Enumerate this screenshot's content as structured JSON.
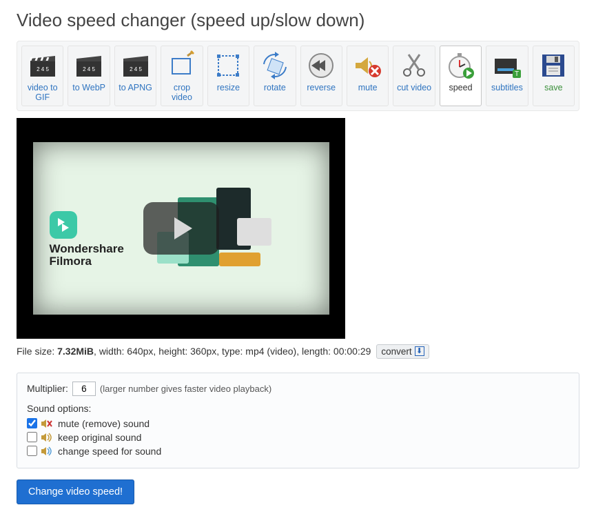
{
  "title": "Video speed changer (speed up/slow down)",
  "toolbar": [
    {
      "key": "gif",
      "label": "video to GIF",
      "active": false
    },
    {
      "key": "webp",
      "label": "to WebP",
      "active": false
    },
    {
      "key": "apng",
      "label": "to APNG",
      "active": false
    },
    {
      "key": "crop",
      "label": "crop video",
      "active": false
    },
    {
      "key": "resize",
      "label": "resize",
      "active": false
    },
    {
      "key": "rotate",
      "label": "rotate",
      "active": false
    },
    {
      "key": "reverse",
      "label": "reverse",
      "active": false
    },
    {
      "key": "mute",
      "label": "mute",
      "active": false
    },
    {
      "key": "cut",
      "label": "cut video",
      "active": false
    },
    {
      "key": "speed",
      "label": "speed",
      "active": true
    },
    {
      "key": "subs",
      "label": "subtitles",
      "active": false
    },
    {
      "key": "save",
      "label": "save",
      "active": false
    }
  ],
  "video": {
    "brand_line1": "Wondershare",
    "brand_line2": "Filmora"
  },
  "fileinfo": {
    "prefix": "File size: ",
    "size": "7.32MiB",
    "rest": ", width: 640px, height: 360px, type: mp4 (video), length: 00:00:29",
    "convert": "convert"
  },
  "form": {
    "multiplier_label": "Multiplier:",
    "multiplier_value": "6",
    "multiplier_hint": "(larger number gives faster video playback)",
    "sound_header": "Sound options:",
    "opt_mute": "mute (remove) sound",
    "opt_keep": "keep original sound",
    "opt_change": "change speed for sound",
    "checked_mute": true,
    "checked_keep": false,
    "checked_change": false,
    "submit": "Change video speed!"
  }
}
